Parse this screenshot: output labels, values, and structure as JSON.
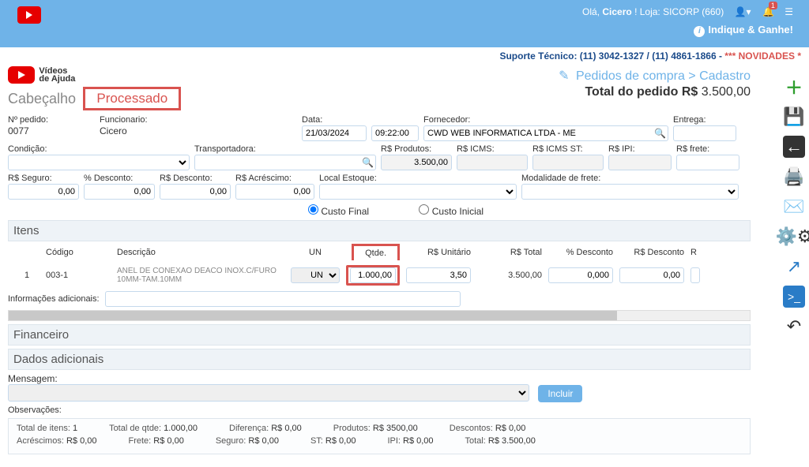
{
  "topbar": {
    "greeting_prefix": "Olá, ",
    "user": "Cicero",
    "greeting_suffix": " ! Loja: SICORP (660)",
    "notif_count": "1",
    "indique": "Indique & Ganhe!"
  },
  "support": {
    "label": "Suporte Técnico: ",
    "phone1": "(11) 3042-1327",
    "sep": " / ",
    "phone2": "(11) 4861-1866",
    "dash": " - ",
    "nov": "*** NOVIDADES *"
  },
  "videos_ajuda": {
    "line1": "Vídeos",
    "line2": "de Ajuda",
    "sub": "YouTube"
  },
  "breadcrumb": {
    "a": "Pedidos de compra",
    "sep": " > ",
    "b": "Cadastro"
  },
  "total_line": {
    "label": "Total do pedido R$ ",
    "value": "3.500,00"
  },
  "header": {
    "cabecalho": "Cabeçalho",
    "processado": "Processado"
  },
  "form": {
    "npedido_lbl": "Nº pedido:",
    "npedido": "0077",
    "func_lbl": "Funcionario:",
    "func": "Cicero",
    "data_lbl": "Data:",
    "data": "21/03/2024",
    "hora": "09:22:00",
    "forn_lbl": "Fornecedor:",
    "forn": "CWD WEB INFORMATICA LTDA - ME",
    "entrega_lbl": "Entrega:",
    "entrega": "",
    "cond_lbl": "Condição:",
    "transp_lbl": "Transportadora:",
    "rsprod_lbl": "R$ Produtos:",
    "rsprod": "3.500,00",
    "rsicms_lbl": "R$ ICMS:",
    "rsicms": "",
    "rsicmsst_lbl": "R$ ICMS ST:",
    "rsicmsst": "",
    "rsipi_lbl": "R$ IPI:",
    "rsipi": "",
    "rsfrete_lbl": "R$ frete:",
    "rsfrete": "",
    "rsseg_lbl": "R$ Seguro:",
    "rsseg": "0,00",
    "pdesc_lbl": "% Desconto:",
    "pdesc": "0,00",
    "rsdesc_lbl": "R$ Desconto:",
    "rsdesc": "0,00",
    "rsacr_lbl": "R$ Acréscimo:",
    "rsacr": "0,00",
    "locest_lbl": "Local Estoque:",
    "modfrete_lbl": "Modalidade de frete:",
    "custo_final": "Custo Final",
    "custo_inicial": "Custo Inicial"
  },
  "itens": {
    "title": "Itens",
    "h_cod": "Código",
    "h_desc": "Descrição",
    "h_un": "UN",
    "h_qtd": "Qtde.",
    "h_unit": "R$ Unitário",
    "h_tot": "R$ Total",
    "h_pdesc": "% Desconto",
    "h_rdesc": "R$ Desconto",
    "h_r": "R",
    "rows": [
      {
        "num": "1",
        "cod": "003-1",
        "desc": "ANEL DE CONEXAO DEACO INOX.C/FURO 10MM-TAM.10MM",
        "un": "UN",
        "qtd": "1.000,00",
        "unit": "3,50",
        "tot": "3.500,00",
        "pdesc": "0,000",
        "rdesc": "0,00"
      }
    ],
    "info_lbl": "Informações adicionais:",
    "info": ""
  },
  "financeiro": "Financeiro",
  "dados": "Dados adicionais",
  "msg": {
    "label": "Mensagem:",
    "incluir": "Incluir",
    "obs_lbl": "Observações:"
  },
  "totals": {
    "ti_lbl": "Total de itens: ",
    "ti": "1",
    "tq_lbl": "Total de qtde: ",
    "tq": "1.000,00",
    "dif_lbl": "Diferença: ",
    "dif": "R$ 0,00",
    "prod_lbl": "Produtos: ",
    "prod": "R$ 3500,00",
    "desc_lbl": "Descontos: ",
    "desc": "R$ 0,00",
    "acr_lbl": "Acréscimos: ",
    "acr": "R$ 0,00",
    "frete_lbl": "Frete: ",
    "frete": "R$ 0,00",
    "seg_lbl": "Seguro: ",
    "seg": "R$ 0,00",
    "st_lbl": "ST: ",
    "st": "R$ 0,00",
    "ipi_lbl": "IPI: ",
    "ipi": "R$ 0,00",
    "tot_lbl": "Total: ",
    "tot": "R$ 3.500,00"
  }
}
